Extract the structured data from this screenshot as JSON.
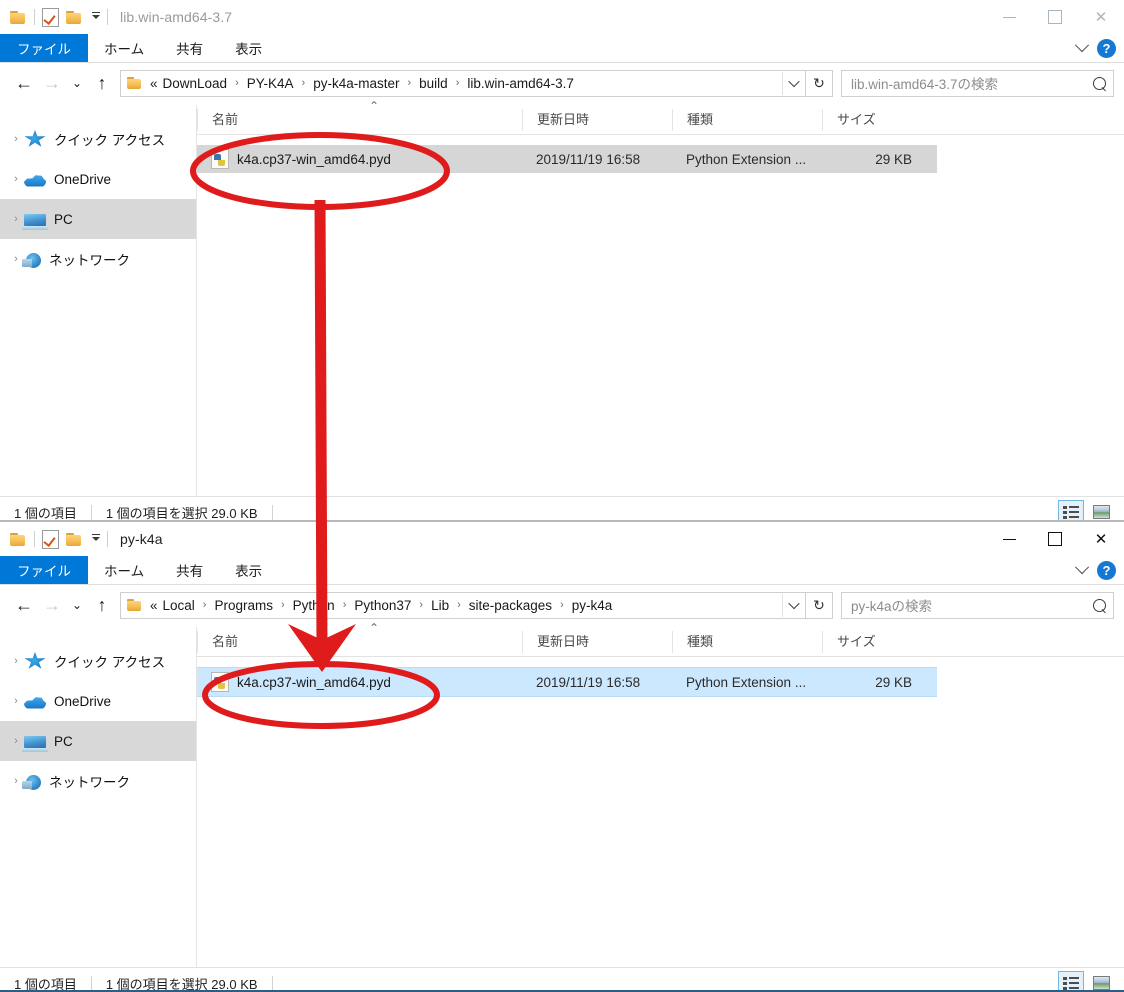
{
  "windows": [
    {
      "title": "lib.win-amd64-3.7",
      "active": false,
      "quick_access_toolbar": {
        "folder_icon": "folder-icon",
        "properties_icon": "properties-icon",
        "new_folder_icon": "new-folder-icon",
        "customize_icon": "customize-caret-icon"
      },
      "window_controls": {
        "minimize": "minimize-icon",
        "maximize": "maximize-icon",
        "close": "close-icon"
      },
      "ribbon": {
        "tabs": [
          "ファイル",
          "ホーム",
          "共有",
          "表示"
        ],
        "collapse_icon": "chevron-down-icon",
        "help_label": "?"
      },
      "nav": {
        "back_icon": "back-arrow-icon",
        "forward_icon": "forward-arrow-icon",
        "recent_icon": "recent-locations-icon",
        "up_icon": "up-arrow-icon",
        "refresh_icon": "↻"
      },
      "address": {
        "ellipsis": "«",
        "crumbs": [
          "DownLoad",
          "PY-K4A",
          "py-k4a-master",
          "build",
          "lib.win-amd64-3.7"
        ],
        "separator": "›"
      },
      "search": {
        "placeholder": "lib.win-amd64-3.7の検索"
      },
      "sidebar": {
        "items": [
          {
            "label": "クイック アクセス",
            "icon": "quick-access-icon",
            "selected": false
          },
          {
            "label": "OneDrive",
            "icon": "onedrive-icon",
            "selected": false
          },
          {
            "label": "PC",
            "icon": "pc-icon",
            "selected": true
          },
          {
            "label": "ネットワーク",
            "icon": "network-icon",
            "selected": false
          }
        ]
      },
      "file_list": {
        "columns": [
          "名前",
          "更新日時",
          "種類",
          "サイズ"
        ],
        "sort_indicator": "⌃",
        "rows": [
          {
            "name": "k4a.cp37-win_amd64.pyd",
            "icon": "python-extension-file-icon",
            "date": "2019/11/19 16:58",
            "type": "Python Extension ...",
            "size": "29 KB",
            "selected": true,
            "selection_style": "gray"
          }
        ]
      },
      "status": {
        "item_count": "1 個の項目",
        "selection": "1 個の項目を選択  29.0 KB"
      },
      "view_toggles": {
        "details": {
          "icon": "details-view-icon",
          "active": true
        },
        "thumbnails": {
          "icon": "large-icons-view-icon",
          "active": false
        }
      }
    },
    {
      "title": "py-k4a",
      "active": true,
      "quick_access_toolbar": {
        "folder_icon": "folder-icon",
        "properties_icon": "properties-icon",
        "new_folder_icon": "new-folder-icon",
        "customize_icon": "customize-caret-icon"
      },
      "window_controls": {
        "minimize": "minimize-icon",
        "maximize": "maximize-icon",
        "close": "close-icon"
      },
      "ribbon": {
        "tabs": [
          "ファイル",
          "ホーム",
          "共有",
          "表示"
        ],
        "collapse_icon": "chevron-down-icon",
        "help_label": "?"
      },
      "nav": {
        "back_icon": "back-arrow-icon",
        "forward_icon": "forward-arrow-icon",
        "recent_icon": "recent-locations-icon",
        "up_icon": "up-arrow-icon",
        "refresh_icon": "↻"
      },
      "address": {
        "ellipsis": "«",
        "crumbs": [
          "Local",
          "Programs",
          "Python",
          "Python37",
          "Lib",
          "site-packages",
          "py-k4a"
        ],
        "separator": "›"
      },
      "search": {
        "placeholder": "py-k4aの検索"
      },
      "sidebar": {
        "items": [
          {
            "label": "クイック アクセス",
            "icon": "quick-access-icon",
            "selected": false
          },
          {
            "label": "OneDrive",
            "icon": "onedrive-icon",
            "selected": false
          },
          {
            "label": "PC",
            "icon": "pc-icon",
            "selected": true
          },
          {
            "label": "ネットワーク",
            "icon": "network-icon",
            "selected": false
          }
        ]
      },
      "file_list": {
        "columns": [
          "名前",
          "更新日時",
          "種類",
          "サイズ"
        ],
        "sort_indicator": "⌃",
        "rows": [
          {
            "name": "k4a.cp37-win_amd64.pyd",
            "icon": "python-extension-file-icon",
            "date": "2019/11/19 16:58",
            "type": "Python Extension ...",
            "size": "29 KB",
            "selected": true,
            "selection_style": "blue"
          }
        ]
      },
      "status": {
        "item_count": "1 個の項目",
        "selection": "1 個の項目を選択  29.0 KB"
      },
      "view_toggles": {
        "details": {
          "icon": "details-view-icon",
          "active": true
        },
        "thumbnails": {
          "icon": "large-icons-view-icon",
          "active": false
        }
      }
    }
  ],
  "annotation": {
    "color": "#e01b1b",
    "shapes": [
      "ellipse-around-source-file",
      "arrow-from-source-to-destination",
      "ellipse-around-destination-file"
    ]
  },
  "colors": {
    "accent": "#0078d7",
    "selection_blue": "#cce8ff",
    "selection_gray": "#d6d6d6",
    "annotation_red": "#e01b1b"
  }
}
